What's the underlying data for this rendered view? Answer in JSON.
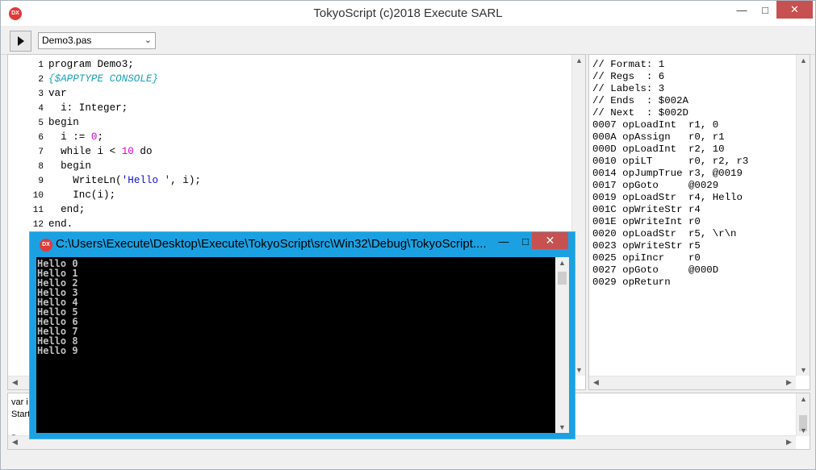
{
  "window": {
    "title": "TokyoScript (c)2018 Execute SARL",
    "app_icon": "DX",
    "minimize_glyph": "—",
    "maximize_glyph": "□",
    "close_glyph": "✕"
  },
  "toolbar": {
    "run_icon": "play-icon",
    "file_select_value": "Demo3.pas",
    "chevron": "⌄"
  },
  "editor": {
    "line_numbers": [
      "1",
      "2",
      "3",
      "4",
      "5",
      "6",
      "7",
      "8",
      "9",
      "10",
      "11",
      "12"
    ],
    "lines": [
      [
        {
          "t": "kw",
          "v": "program Demo3;"
        }
      ],
      [
        {
          "t": "cm",
          "v": "{$APPTYPE CONSOLE}"
        }
      ],
      [
        {
          "t": "kw",
          "v": "var"
        }
      ],
      [
        {
          "t": "kw",
          "v": "  i: Integer;"
        }
      ],
      [
        {
          "t": "kw",
          "v": "begin"
        }
      ],
      [
        {
          "t": "kw",
          "v": "  i := "
        },
        {
          "t": "num",
          "v": "0"
        },
        {
          "t": "kw",
          "v": ";"
        }
      ],
      [
        {
          "t": "kw",
          "v": "  while i < "
        },
        {
          "t": "num",
          "v": "10"
        },
        {
          "t": "kw",
          "v": " do"
        }
      ],
      [
        {
          "t": "kw",
          "v": "  begin"
        }
      ],
      [
        {
          "t": "kw",
          "v": "    WriteLn("
        },
        {
          "t": "str",
          "v": "'Hello '"
        },
        {
          "t": "kw",
          "v": ", i);"
        }
      ],
      [
        {
          "t": "kw",
          "v": "    Inc(i);"
        }
      ],
      [
        {
          "t": "kw",
          "v": "  end;"
        }
      ],
      [
        {
          "t": "kw",
          "v": "end."
        }
      ]
    ]
  },
  "asm": {
    "lines": [
      "// Format: 1",
      "// Regs  : 6",
      "// Labels: 3",
      "// Ends  : $002A",
      "// Next  : $002D",
      "0007 opLoadInt  r1, 0",
      "000A opAssign   r0, r1",
      "000D opLoadInt  r2, 10",
      "0010 opiLT      r0, r2, r3",
      "0014 opJumpTrue r3, @0019",
      "0017 opGoto     @0029",
      "0019 opLoadStr  r4, Hello",
      "001C opWriteStr r4",
      "001E opWriteInt r0",
      "0020 opLoadStr  r5, \\r\\n",
      "0023 opWriteStr r5",
      "0025 opiIncr    r0",
      "0027 opGoto     @000D",
      "0029 opReturn"
    ]
  },
  "log": {
    "lines": [
      "var i",
      "Start",
      "",
      "Done"
    ]
  },
  "console": {
    "title": "C:\\Users\\Execute\\Desktop\\Execute\\TokyoScript\\src\\Win32\\Debug\\TokyoScript....",
    "output": [
      "Hello 0",
      "Hello 1",
      "Hello 2",
      "Hello 3",
      "Hello 4",
      "Hello 5",
      "Hello 6",
      "Hello 7",
      "Hello 8",
      "Hello 9"
    ]
  },
  "colors": {
    "console_frame": "#1ba1e2",
    "close_button": "#c75050",
    "app_icon": "#e03a3a"
  }
}
